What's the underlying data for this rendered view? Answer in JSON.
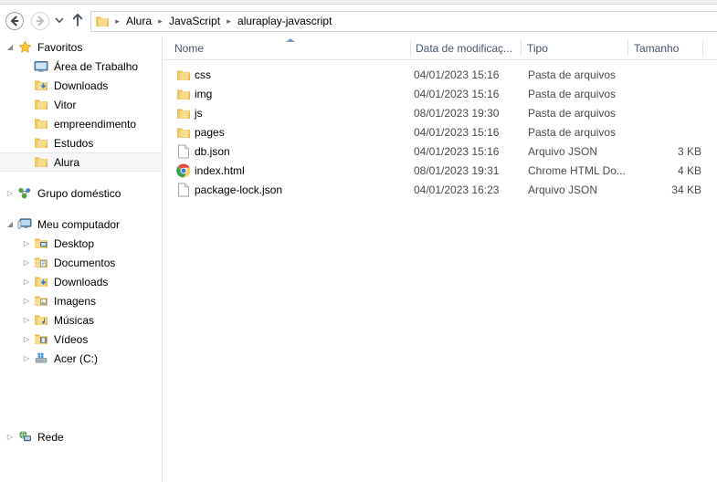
{
  "navbar": {
    "back_icon": "back-arrow-icon",
    "forward_icon": "forward-arrow-icon",
    "history_icon": "chevron-down-icon",
    "up_icon": "up-arrow-icon",
    "breadcrumbs": [
      "Alura",
      "JavaScript",
      "aluraplay-javascript"
    ],
    "separator": "▸"
  },
  "sidebar": {
    "groups": [
      {
        "label": "Favoritos",
        "icon": "star-icon",
        "twisty": "◢",
        "expanded": true,
        "items": [
          {
            "label": "Área de Trabalho",
            "icon": "desktop-icon",
            "selected": false
          },
          {
            "label": "Downloads",
            "icon": "downloads-folder-icon",
            "selected": false
          },
          {
            "label": "Vitor",
            "icon": "folder-icon",
            "selected": false
          },
          {
            "label": "empreendimento",
            "icon": "folder-icon",
            "selected": false
          },
          {
            "label": "Estudos",
            "icon": "folder-icon",
            "selected": false
          },
          {
            "label": "Alura",
            "icon": "folder-icon",
            "selected": true
          }
        ]
      },
      {
        "label": "Grupo doméstico",
        "icon": "homegroup-icon",
        "twisty": "▷",
        "expanded": false,
        "items": []
      },
      {
        "label": "Meu computador",
        "icon": "computer-icon",
        "twisty": "◢",
        "expanded": true,
        "items": [
          {
            "label": "Desktop",
            "icon": "desktop-folder-icon",
            "twisty": "▷",
            "selected": false
          },
          {
            "label": "Documentos",
            "icon": "documents-folder-icon",
            "twisty": "▷",
            "selected": false
          },
          {
            "label": "Downloads",
            "icon": "downloads-folder-icon",
            "twisty": "▷",
            "selected": false
          },
          {
            "label": "Imagens",
            "icon": "pictures-folder-icon",
            "twisty": "▷",
            "selected": false
          },
          {
            "label": "Músicas",
            "icon": "music-folder-icon",
            "twisty": "▷",
            "selected": false
          },
          {
            "label": "Vídeos",
            "icon": "videos-folder-icon",
            "twisty": "▷",
            "selected": false
          },
          {
            "label": "Acer (C:)",
            "icon": "harddrive-icon",
            "twisty": "▷",
            "selected": false
          }
        ]
      },
      {
        "label": "Rede",
        "icon": "network-icon",
        "twisty": "▷",
        "expanded": false,
        "items": []
      }
    ]
  },
  "file_list": {
    "columns": [
      {
        "label": "Nome",
        "sorted": "asc"
      },
      {
        "label": "Data de modificaç...",
        "sorted": ""
      },
      {
        "label": "Tipo",
        "sorted": ""
      },
      {
        "label": "Tamanho",
        "sorted": ""
      }
    ],
    "rows": [
      {
        "name": "css",
        "date": "04/01/2023 15:16",
        "type": "Pasta de arquivos",
        "size": "",
        "icon": "folder-icon"
      },
      {
        "name": "img",
        "date": "04/01/2023 15:16",
        "type": "Pasta de arquivos",
        "size": "",
        "icon": "folder-icon"
      },
      {
        "name": "js",
        "date": "08/01/2023 19:30",
        "type": "Pasta de arquivos",
        "size": "",
        "icon": "folder-icon"
      },
      {
        "name": "pages",
        "date": "04/01/2023 15:16",
        "type": "Pasta de arquivos",
        "size": "",
        "icon": "folder-icon"
      },
      {
        "name": "db.json",
        "date": "04/01/2023 15:16",
        "type": "Arquivo JSON",
        "size": "3 KB",
        "icon": "document-icon"
      },
      {
        "name": "index.html",
        "date": "08/01/2023 19:31",
        "type": "Chrome HTML Do...",
        "size": "4 KB",
        "icon": "chrome-icon"
      },
      {
        "name": "package-lock.json",
        "date": "04/01/2023 16:23",
        "type": "Arquivo JSON",
        "size": "34 KB",
        "icon": "document-icon"
      }
    ]
  },
  "colors": {
    "header_text": "#45586d",
    "folder_yellow": "#f5d77a",
    "sort_arrow": "#6f9dc6",
    "selection": "#f6f6f6"
  }
}
